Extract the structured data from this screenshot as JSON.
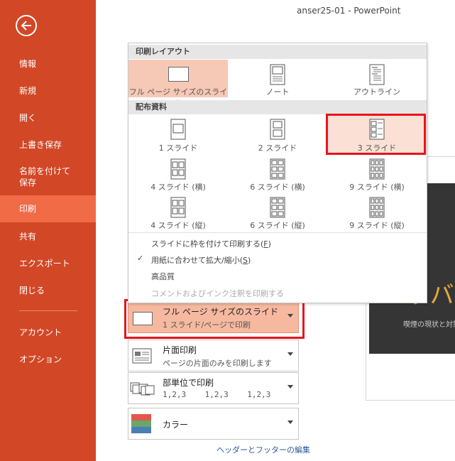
{
  "window": {
    "title": "anser25-01 - PowerPoint"
  },
  "sidebar": {
    "items": [
      {
        "label": "情報"
      },
      {
        "label": "新規"
      },
      {
        "label": "開く"
      },
      {
        "label": "上書き保存"
      },
      {
        "label": "名前を付けて\n保存"
      },
      {
        "label": "印刷"
      },
      {
        "label": "共有"
      },
      {
        "label": "エクスポート"
      },
      {
        "label": "閉じる"
      },
      {
        "label": "アカウント"
      },
      {
        "label": "オプション"
      }
    ],
    "active": "印刷",
    "accent": "#d24726"
  },
  "dropdown": {
    "layout_header": "印刷レイアウト",
    "layout_items": [
      {
        "label": "フル ページ サイズのスライド"
      },
      {
        "label": "ノート"
      },
      {
        "label": "アウトライン"
      }
    ],
    "handout_header": "配布資料",
    "handout_items": [
      {
        "label": "1 スライド"
      },
      {
        "label": "2 スライド"
      },
      {
        "label": "3 スライド"
      },
      {
        "label": "4 スライド (横)"
      },
      {
        "label": "6 スライド (横)"
      },
      {
        "label": "9 スライド (横)"
      },
      {
        "label": "4 スライド (縦)"
      },
      {
        "label": "6 スライド (縦)"
      },
      {
        "label": "9 スライド (縦)"
      }
    ],
    "options": {
      "frame_prefix": "スライドに枠を付けて印刷する(",
      "frame_key": "F",
      "fit_prefix": "用紙に合わせて拡大/縮小(",
      "fit_key": "S",
      "close_paren": ")",
      "high_quality": "高品質",
      "comments": "コメントおよびインク注釈を印刷する"
    }
  },
  "settings": {
    "layout": {
      "main": "フル ページ サイズのスライド",
      "sub": "1 スライド/ページで印刷"
    },
    "sides": {
      "main": "片面印刷",
      "sub": "ページの片面のみを印刷します"
    },
    "collate": {
      "main": "部単位で印刷",
      "sub": "1,2,3    1,2,3    1,2,3"
    },
    "color": {
      "main": "カラー"
    }
  },
  "header_footer_link": "ヘッダーとフッターの編集",
  "preview": {
    "big_text": "ラバ",
    "sub_text": "喫煙の現状と対策"
  }
}
